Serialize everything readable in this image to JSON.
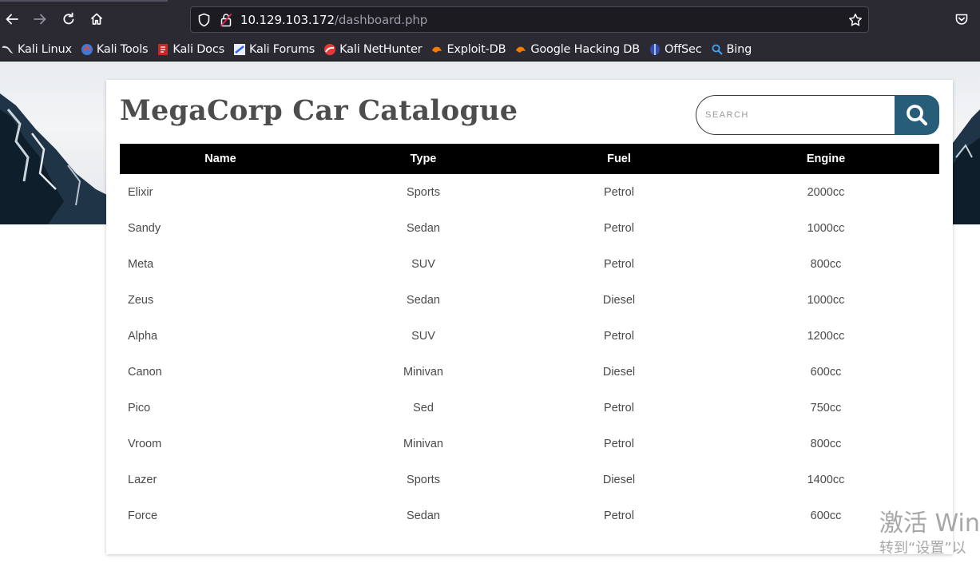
{
  "browser": {
    "url_host": "10.129.103.172",
    "url_path": "/dashboard.php",
    "bookmarks": [
      {
        "label": "Kali Linux",
        "icon": "kali-dragon-icon"
      },
      {
        "label": "Kali Tools",
        "icon": "kali-tools-icon"
      },
      {
        "label": "Kali Docs",
        "icon": "kali-docs-icon"
      },
      {
        "label": "Kali Forums",
        "icon": "kali-forums-icon"
      },
      {
        "label": "Kali NetHunter",
        "icon": "kali-nethunter-icon"
      },
      {
        "label": "Exploit-DB",
        "icon": "exploit-db-icon"
      },
      {
        "label": "Google Hacking DB",
        "icon": "ghdb-icon"
      },
      {
        "label": "OffSec",
        "icon": "offsec-icon"
      },
      {
        "label": "Bing",
        "icon": "bing-search-icon"
      }
    ]
  },
  "page": {
    "title": "MegaCorp Car Catalogue",
    "search": {
      "placeholder": "SEARCH",
      "value": ""
    },
    "table": {
      "headers": [
        "Name",
        "Type",
        "Fuel",
        "Engine"
      ],
      "rows": [
        [
          "Elixir",
          "Sports",
          "Petrol",
          "2000cc"
        ],
        [
          "Sandy",
          "Sedan",
          "Petrol",
          "1000cc"
        ],
        [
          "Meta",
          "SUV",
          "Petrol",
          "800cc"
        ],
        [
          "Zeus",
          "Sedan",
          "Diesel",
          "1000cc"
        ],
        [
          "Alpha",
          "SUV",
          "Petrol",
          "1200cc"
        ],
        [
          "Canon",
          "Minivan",
          "Diesel",
          "600cc"
        ],
        [
          "Pico",
          "Sed",
          "Petrol",
          "750cc"
        ],
        [
          "Vroom",
          "Minivan",
          "Petrol",
          "800cc"
        ],
        [
          "Lazer",
          "Sports",
          "Diesel",
          "1400cc"
        ],
        [
          "Force",
          "Sedan",
          "Petrol",
          "600cc"
        ]
      ]
    }
  },
  "watermark": {
    "line1": "激活 Win",
    "line2": "转到“设置”以"
  },
  "colors": {
    "browser_bg": "#2b2a33",
    "search_button": "#275d78",
    "table_header_bg": "#000000",
    "title_text": "#4d4d4d"
  }
}
